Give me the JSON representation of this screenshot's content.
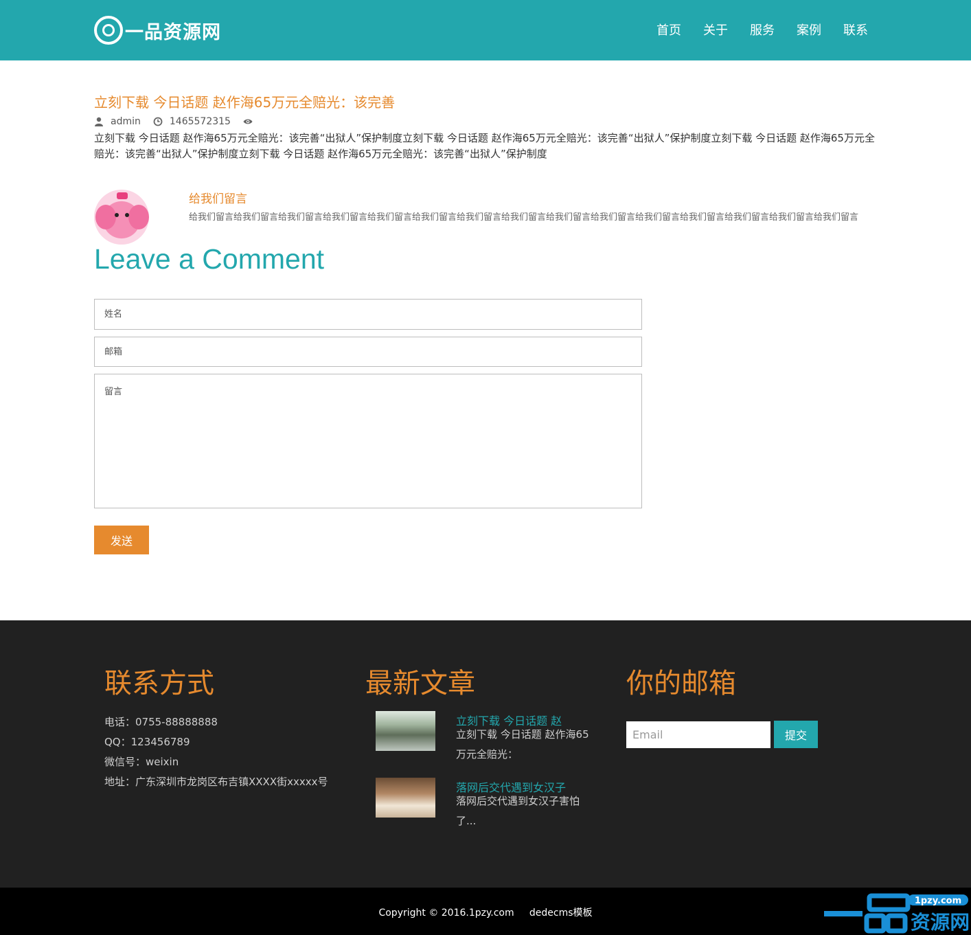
{
  "header": {
    "logo_text": "一品资源网",
    "nav": [
      "首页",
      "关于",
      "服务",
      "案例",
      "联系"
    ]
  },
  "article": {
    "title": "立刻下载 今日话题 赵作海65万元全赔光：该完善",
    "author": "admin",
    "time": "1465572315",
    "body": "立刻下载 今日话题 赵作海65万元全赔光：该完善“出狱人”保护制度立刻下载 今日话题 赵作海65万元全赔光：该完善“出狱人”保护制度立刻下载 今日话题 赵作海65万元全赔光：该完善“出狱人”保护制度立刻下载 今日话题 赵作海65万元全赔光：该完善“出狱人”保护制度"
  },
  "message": {
    "title": "给我们留言",
    "body": "给我们留言给我们留言给我们留言给我们留言给我们留言给我们留言给我们留言给我们留言给我们留言给我们留言给我们留言给我们留言给我们留言给我们留言给我们留言"
  },
  "comment_form": {
    "heading": "Leave a Comment",
    "name_placeholder": "姓名",
    "email_placeholder": "邮箱",
    "message_placeholder": "留言",
    "submit_label": "发送"
  },
  "footer": {
    "contact": {
      "heading": "联系方式",
      "lines": [
        "电话：0755-88888888",
        "QQ：123456789",
        "微信号：weixin",
        "地址：广东深圳市龙岗区布吉镇XXXX街xxxxx号"
      ]
    },
    "news": {
      "heading": "最新文章",
      "items": [
        {
          "title": "立刻下载 今日话题 赵",
          "desc": "立刻下载 今日话题 赵作海65万元全赔光："
        },
        {
          "title": "落网后交代遇到女汉子",
          "desc": "落网后交代遇到女汉子害怕了..."
        }
      ]
    },
    "email": {
      "heading": "你的邮箱",
      "placeholder": "Email",
      "submit_label": "提交"
    },
    "copyright": "Copyright © 2016.1pzy.com     dedecms模板"
  },
  "watermark": {
    "top_text": "1pzy.com",
    "main_text": "一品资源网"
  },
  "colors": {
    "brand_teal": "#23a7ad",
    "accent_orange": "#e68a2e",
    "footer_bg": "#212121"
  }
}
